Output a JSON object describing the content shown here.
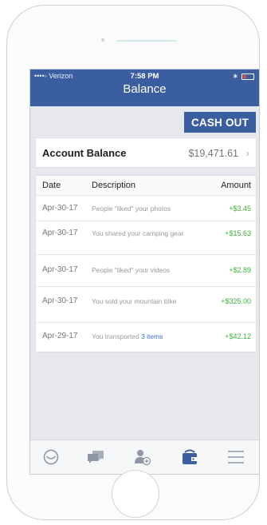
{
  "status_bar": {
    "carrier": "••••◦ Verizon",
    "time": "7:58 PM"
  },
  "nav": {
    "title": "Balance"
  },
  "actions": {
    "cash_out_label": "CASH OUT"
  },
  "account": {
    "label": "Account Balance",
    "value": "$19,471.61"
  },
  "table": {
    "headers": {
      "date": "Date",
      "description": "Description",
      "amount": "Amount"
    },
    "rows": [
      {
        "date": "Apr-30-17",
        "description": "People \"liked\" your photos",
        "link": "",
        "amount": "+$3.45"
      },
      {
        "date": "Apr-30-17",
        "description": "You shared your camping gear",
        "link": "",
        "amount": "+$15.63"
      },
      {
        "date": "Apr-30-17",
        "description": "People \"liked\" your videos",
        "link": "",
        "amount": "+$2.89"
      },
      {
        "date": "Apr-30-17",
        "description": "You sold your mountain bike",
        "link": "",
        "amount": "+$325.00"
      },
      {
        "date": "Apr-29-17",
        "description": "You transported ",
        "link": "3 items",
        "amount": "+$42.12"
      }
    ]
  },
  "tabs": [
    {
      "name": "tab-home",
      "icon": "smile-icon"
    },
    {
      "name": "tab-messages",
      "icon": "chat-bubbles-icon"
    },
    {
      "name": "tab-add-friend",
      "icon": "add-person-icon"
    },
    {
      "name": "tab-wallet",
      "icon": "wallet-icon"
    },
    {
      "name": "tab-menu",
      "icon": "hamburger-menu-icon"
    }
  ],
  "colors": {
    "brand": "#3b5ea0",
    "amount_positive": "#3cae3c",
    "link": "#3b6fc6"
  }
}
